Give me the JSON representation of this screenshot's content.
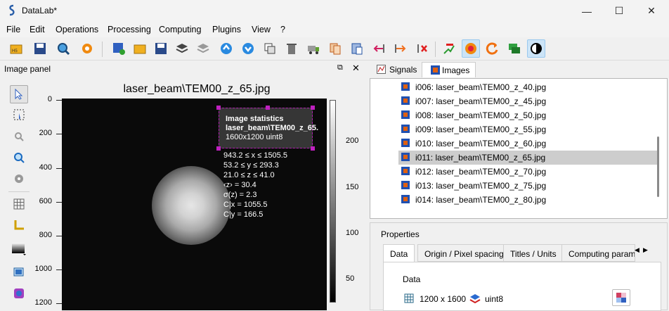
{
  "window": {
    "title": "DataLab*"
  },
  "menu": [
    "File",
    "Edit",
    "Operations",
    "Processing",
    "Computing",
    "Plugins",
    "View",
    "?"
  ],
  "image_panel": {
    "title": "Image panel",
    "plot_title": "laser_beam\\TEM00_z_65.jpg",
    "y_ticks": [
      "0",
      "200",
      "400",
      "600",
      "800",
      "1000",
      "1200"
    ],
    "colorbar_ticks": [
      "200",
      "150",
      "100",
      "50"
    ],
    "stats": {
      "heading": "Image statistics",
      "name": "laser_beam\\TEM00_z_65.",
      "size": "1600x1200 uint8",
      "body": "943.2 ≤ x ≤ 1505.5\n53.2 ≤ y ≤ 293.3\n21.0 ≤ z ≤ 41.0\n‹z› = 30.4\nσ(z) = 2.3\nC|x = 1055.5\nC|y = 166.5"
    }
  },
  "tabs": [
    "Signals",
    "Images"
  ],
  "images": [
    "i006: laser_beam\\TEM00_z_40.jpg",
    "i007: laser_beam\\TEM00_z_45.jpg",
    "i008: laser_beam\\TEM00_z_50.jpg",
    "i009: laser_beam\\TEM00_z_55.jpg",
    "i010: laser_beam\\TEM00_z_60.jpg",
    "i011: laser_beam\\TEM00_z_65.jpg",
    "i012: laser_beam\\TEM00_z_70.jpg",
    "i013: laser_beam\\TEM00_z_75.jpg",
    "i014: laser_beam\\TEM00_z_80.jpg"
  ],
  "selected_image_index": 5,
  "properties": {
    "title": "Properties",
    "tabs": [
      "Data",
      "Origin / Pixel spacing",
      "Titles / Units",
      "Computing parame"
    ],
    "group": "Data",
    "dims": "1200 x 1600",
    "dtype": "uint8"
  }
}
